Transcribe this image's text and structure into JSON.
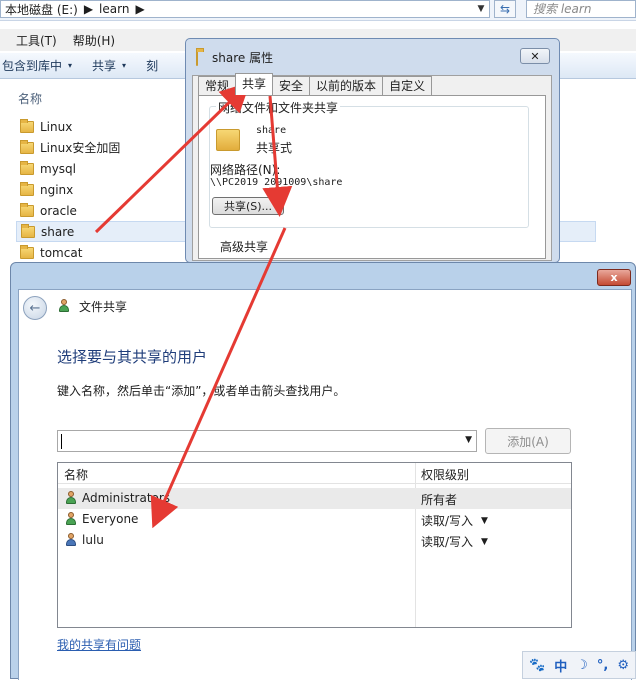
{
  "explorer": {
    "address": {
      "segments": [
        "本地磁盘 (E:)",
        "learn"
      ],
      "search_placeholder": "搜索 learn"
    },
    "menu": [
      "工具(T)",
      "帮助(H)"
    ],
    "toolbar": [
      {
        "label": "包含到库中",
        "caret": "▾"
      },
      {
        "label": "共享",
        "caret": "▾"
      },
      {
        "label": "刻",
        "caret": ""
      }
    ],
    "column_header": "名称",
    "files": [
      "Linux",
      "Linux安全加固",
      "mysql",
      "nginx",
      "oracle",
      "share",
      "tomcat"
    ],
    "selected_file": "share"
  },
  "props": {
    "title": "share 属性",
    "close": "✕",
    "tabs": [
      "常规",
      "共享",
      "安全",
      "以前的版本",
      "自定义"
    ],
    "active_tab": "共享",
    "group1_title": "网络文件和文件夹共享",
    "folder_name": "share",
    "share_state": "共享式",
    "network_path_label": "网络路径(N):",
    "network_path": "\\\\PC2019 2091009\\share",
    "share_button": "共享(S)...",
    "group2_title": "高级共享"
  },
  "wizard": {
    "close": "x",
    "back_glyph": "←",
    "title": "文件共享",
    "heading": "选择要与其共享的用户",
    "description": "键入名称，然后单击“添加”，或者单击箭头查找用户。",
    "combo_value": "",
    "add_button": "添加(A)",
    "columns": [
      "名称",
      "权限级别"
    ],
    "users": [
      {
        "name": "Administrators",
        "permission": "所有者",
        "has_dropdown": false,
        "icon": "group-icon"
      },
      {
        "name": "Everyone",
        "permission": "读取/写入",
        "has_dropdown": true,
        "icon": "group-icon"
      },
      {
        "name": "lulu",
        "permission": "读取/写入",
        "has_dropdown": true,
        "icon": "user-icon"
      }
    ],
    "problem_link": "我的共享有问题"
  },
  "tray": [
    "🐾",
    "中",
    "☽",
    "°,",
    "⚙"
  ],
  "colors": {
    "annotation_arrow": "#e53a33",
    "heading": "#1f3d7a",
    "link": "#2a5db0"
  }
}
